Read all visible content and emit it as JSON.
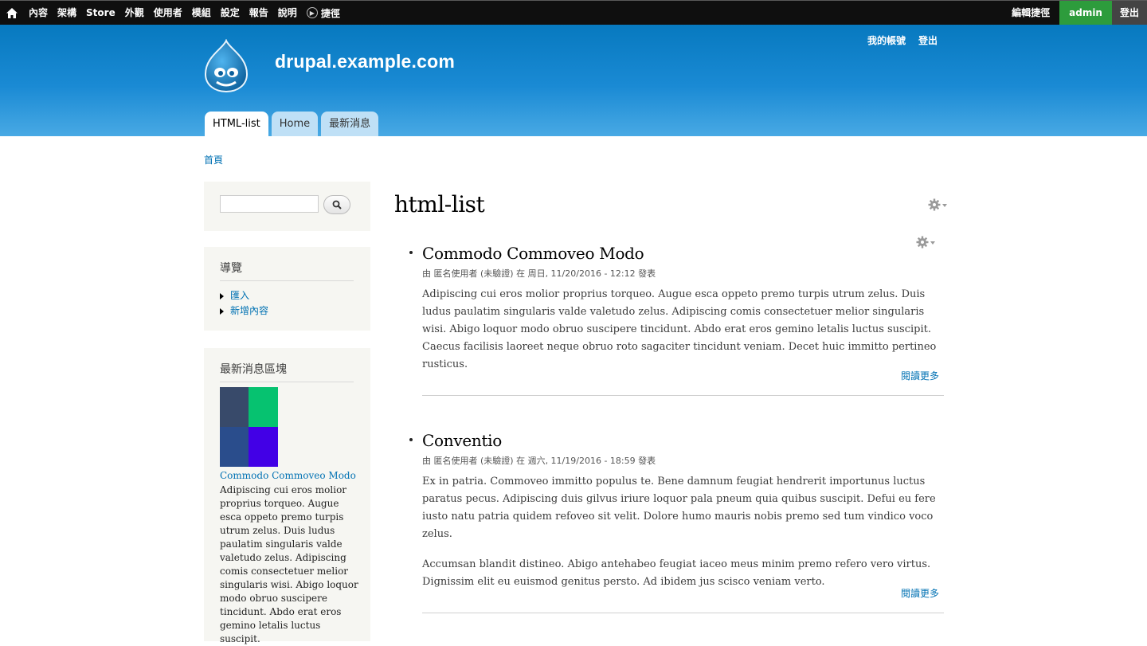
{
  "toolbar": {
    "menu": [
      "內容",
      "架構",
      "Store",
      "外觀",
      "使用者",
      "模組",
      "設定",
      "報告",
      "說明"
    ],
    "shortcuts_label": "捷徑",
    "edit_shortcuts": "編輯捷徑",
    "user": "admin",
    "logout": "登出"
  },
  "header": {
    "site_name": "drupal.example.com",
    "secondary_menu": [
      "我的帳號",
      "登出"
    ],
    "main_menu": [
      {
        "label": "HTML-list",
        "active": true
      },
      {
        "label": "Home",
        "active": false
      },
      {
        "label": "最新消息",
        "active": false
      }
    ]
  },
  "breadcrumb": "首頁",
  "sidebar": {
    "navigation": {
      "title": "導覽",
      "items": [
        "匯入",
        "新增內容"
      ]
    },
    "news_block": {
      "title": "最新消息區塊",
      "link": "Commodo Commoveo Modo",
      "text": "Adipiscing cui eros molior proprius torqueo. Augue esca oppeto premo turpis utrum zelus. Duis ludus paulatim singularis valde valetudo zelus. Adipiscing comis consectetuer melior singularis wisi. Abigo loquor modo obruo suscipere tincidunt. Abdo erat eros gemino letalis luctus suscipit.",
      "image_colors": [
        "#384a6a",
        "#06c270",
        "#2a4d8c",
        "#4200e6"
      ]
    }
  },
  "main": {
    "title": "html-list",
    "articles": [
      {
        "title": "Commodo Commoveo Modo",
        "meta": "由 匿名使用者 (未驗證) 在 周日, 11/20/2016 - 12:12 發表",
        "paragraphs": [
          "Adipiscing cui eros molior proprius torqueo. Augue esca oppeto premo turpis utrum zelus. Duis ludus paulatim singularis valde valetudo zelus. Adipiscing comis consectetuer melior singularis wisi. Abigo loquor modo obruo suscipere tincidunt. Abdo erat eros gemino letalis luctus suscipit. Caecus facilisis laoreet neque obruo roto sagaciter tincidunt veniam. Decet huic immitto pertineo rusticus."
        ],
        "read_more": "閱讀更多"
      },
      {
        "title": "Conventio",
        "meta": "由 匿名使用者 (未驗證) 在 週六, 11/19/2016 - 18:59 發表",
        "paragraphs": [
          "Ex in patria. Commoveo immitto populus te. Bene damnum feugiat hendrerit importunus luctus paratus pecus. Adipiscing duis gilvus iriure loquor pala pneum quia quibus suscipit. Defui eu fere iusto natu patria quidem refoveo sit velit. Dolore humo mauris nobis premo sed tum vindico voco zelus.",
          "Accumsan blandit distineo. Abigo antehabeo feugiat iaceo meus minim premo refero vero virtus. Dignissim elit eu euismod genitus persto. Ad ibidem jus scisco veniam verto."
        ],
        "read_more": "閱讀更多"
      }
    ]
  }
}
